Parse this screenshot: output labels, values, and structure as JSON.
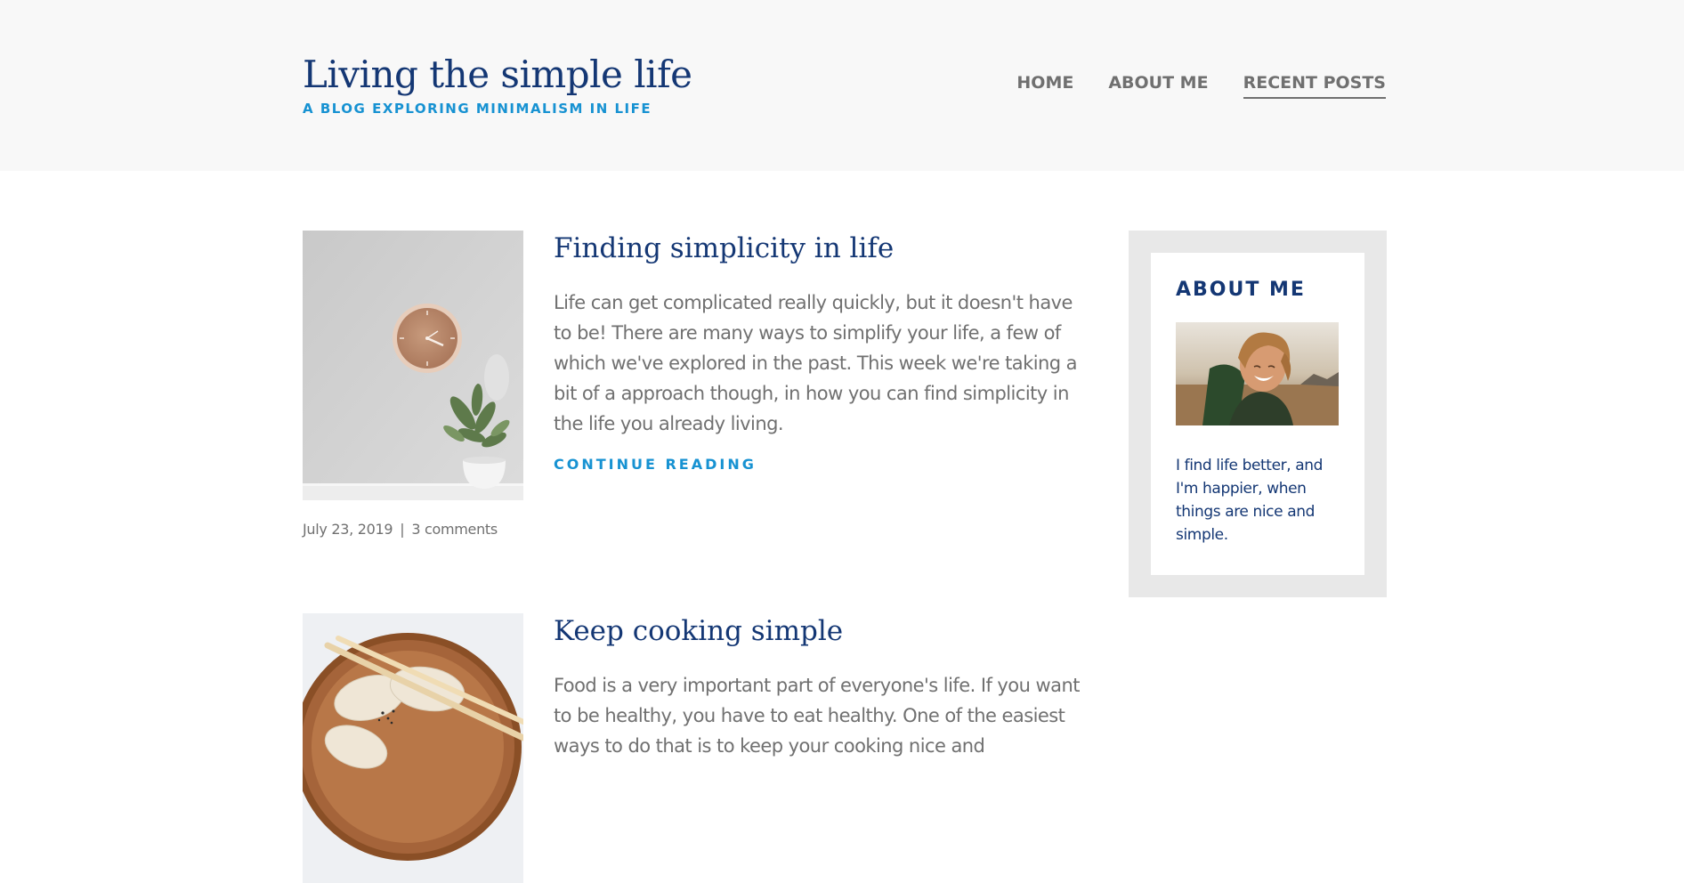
{
  "site": {
    "title": "Living the simple life",
    "subtitle": "A blog exploring minimalism in life"
  },
  "nav": {
    "items": [
      {
        "label": "Home",
        "current": false
      },
      {
        "label": "About me",
        "current": false
      },
      {
        "label": "Recent posts",
        "current": true
      }
    ]
  },
  "posts": [
    {
      "title": "Finding simplicity in life",
      "excerpt": "Life can get complicated really quickly, but it doesn't have to be! There are many ways to simplify your life, a few of which we've explored in the past. This week we're taking a bit of a approach though, in how you can find simplicity in the life you already living.",
      "read_more": "Continue reading",
      "date": "July 23, 2019",
      "separator": "|",
      "comments": "3 comments",
      "thumbnail": "clock-and-plant-photo"
    },
    {
      "title": "Keep cooking simple",
      "excerpt": "Food is a very important part of everyone's life. If you want to be healthy, you have to eat healthy. One of the easiest ways to do that is to keep your cooking nice and",
      "thumbnail": "dumplings-with-chopsticks-photo"
    }
  ],
  "sidebar": {
    "about": {
      "title": "About me",
      "image": "smiling-man-portrait-photo",
      "text": "I find life better, and I'm happier, when things are nice and simple."
    }
  },
  "colors": {
    "primary": "#143774",
    "accent": "#1792d2",
    "text": "#707070",
    "header_bg": "#f8f8f8",
    "widget_bg": "#e8e8e8"
  }
}
